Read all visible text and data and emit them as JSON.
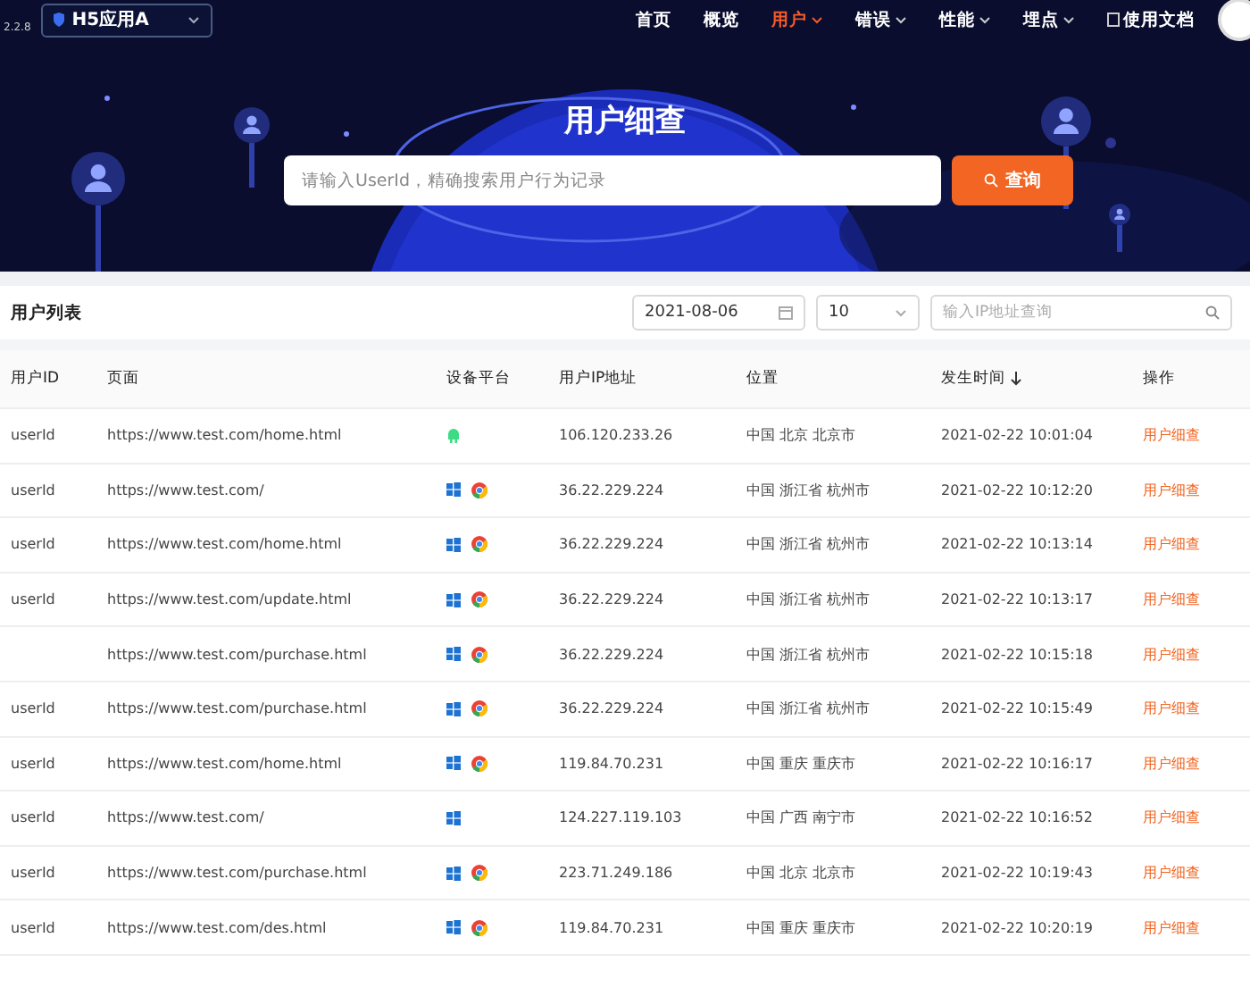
{
  "header": {
    "version": "2.2.8",
    "app_selector": {
      "value": "H5应用A"
    },
    "nav": [
      {
        "label": "首页",
        "selected": false,
        "has_menu": false,
        "kind": "link"
      },
      {
        "label": "概览",
        "selected": false,
        "has_menu": false,
        "kind": "link"
      },
      {
        "label": "用户",
        "selected": true,
        "has_menu": true,
        "kind": "link"
      },
      {
        "label": "错误",
        "selected": false,
        "has_menu": true,
        "kind": "link"
      },
      {
        "label": "性能",
        "selected": false,
        "has_menu": true,
        "kind": "link"
      },
      {
        "label": "埋点",
        "selected": false,
        "has_menu": true,
        "kind": "link"
      },
      {
        "label": "使用文档",
        "selected": false,
        "has_menu": false,
        "kind": "doc"
      }
    ]
  },
  "banner": {
    "title": "用户细查",
    "search": {
      "placeholder": "请输入UserId，精确搜索用户行为记录"
    },
    "search_button": "查询"
  },
  "list": {
    "title": "用户列表",
    "date": "2021-08-06",
    "page_size": "10",
    "ip_search": {
      "placeholder": "输入IP地址查询"
    },
    "columns": [
      {
        "label": "用户ID",
        "sorted": false
      },
      {
        "label": "页面",
        "sorted": false
      },
      {
        "label": "设备平台",
        "sorted": false
      },
      {
        "label": "用户IP地址",
        "sorted": false
      },
      {
        "label": "位置",
        "sorted": false
      },
      {
        "label": "发生时间",
        "sorted": true
      },
      {
        "label": "操作",
        "sorted": false
      }
    ],
    "rows": [
      {
        "user_id": "userId",
        "page": "https://www.test.com/home.html",
        "platforms": [
          {
            "kind": "android"
          }
        ],
        "ip": "106.120.233.26",
        "location": "中国 北京 北京市",
        "time": "2021-02-22 10:01:04",
        "action": "用户细查"
      },
      {
        "user_id": "userId",
        "page": "https://www.test.com/",
        "platforms": [
          {
            "kind": "windows"
          },
          {
            "kind": "chrome"
          }
        ],
        "ip": "36.22.229.224",
        "location": "中国 浙江省 杭州市",
        "time": "2021-02-22 10:12:20",
        "action": "用户细查"
      },
      {
        "user_id": "userId",
        "page": "https://www.test.com/home.html",
        "platforms": [
          {
            "kind": "windows"
          },
          {
            "kind": "chrome"
          }
        ],
        "ip": "36.22.229.224",
        "location": "中国 浙江省 杭州市",
        "time": "2021-02-22 10:13:14",
        "action": "用户细查"
      },
      {
        "user_id": "userId",
        "page": "https://www.test.com/update.html",
        "platforms": [
          {
            "kind": "windows"
          },
          {
            "kind": "chrome"
          }
        ],
        "ip": "36.22.229.224",
        "location": "中国 浙江省 杭州市",
        "time": "2021-02-22 10:13:17",
        "action": "用户细查"
      },
      {
        "page": "https://www.test.com/purchase.html",
        "platforms": [
          {
            "kind": "windows"
          },
          {
            "kind": "chrome"
          }
        ],
        "ip": "36.22.229.224",
        "location": "中国 浙江省 杭州市",
        "time": "2021-02-22 10:15:18",
        "action": "用户细查"
      },
      {
        "user_id": "userId",
        "page": "https://www.test.com/purchase.html",
        "platforms": [
          {
            "kind": "windows"
          },
          {
            "kind": "chrome"
          }
        ],
        "ip": "36.22.229.224",
        "location": "中国 浙江省 杭州市",
        "time": "2021-02-22 10:15:49",
        "action": "用户细查"
      },
      {
        "user_id": "userId",
        "page": "https://www.test.com/home.html",
        "platforms": [
          {
            "kind": "windows"
          },
          {
            "kind": "chrome"
          }
        ],
        "ip": "119.84.70.231",
        "location": "中国 重庆 重庆市",
        "time": "2021-02-22 10:16:17",
        "action": "用户细查"
      },
      {
        "user_id": "userId",
        "page": "https://www.test.com/",
        "platforms": [
          {
            "kind": "windows"
          }
        ],
        "ip": "124.227.119.103",
        "location": "中国 广西 南宁市",
        "time": "2021-02-22 10:16:52",
        "action": "用户细查"
      },
      {
        "user_id": "userId",
        "page": "https://www.test.com/purchase.html",
        "platforms": [
          {
            "kind": "windows"
          },
          {
            "kind": "chrome"
          }
        ],
        "ip": "223.71.249.186",
        "location": "中国 北京 北京市",
        "time": "2021-02-22 10:19:43",
        "action": "用户细查"
      },
      {
        "user_id": "userId",
        "page": "https://www.test.com/des.html",
        "platforms": [
          {
            "kind": "windows"
          },
          {
            "kind": "chrome"
          }
        ],
        "ip": "119.84.70.231",
        "location": "中国 重庆 重庆市",
        "time": "2021-02-22 10:20:19",
        "action": "用户细查"
      }
    ]
  }
}
